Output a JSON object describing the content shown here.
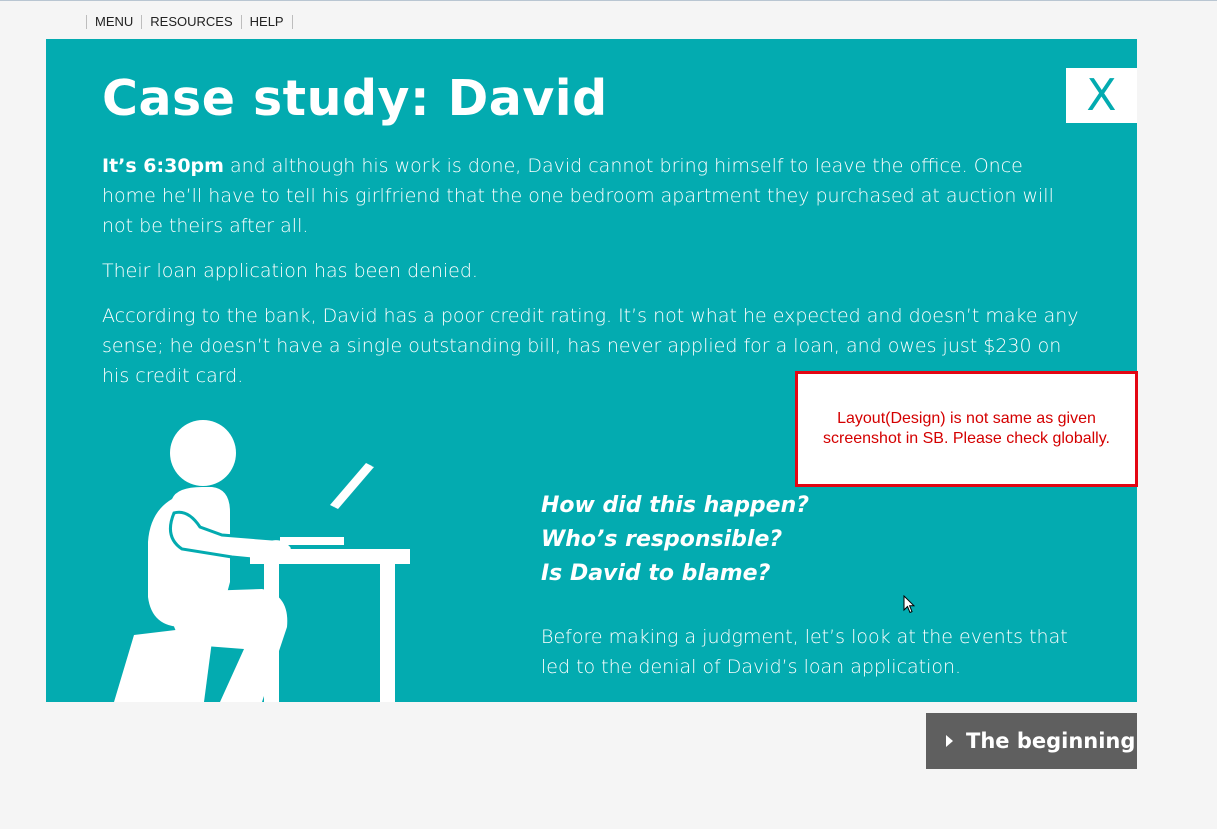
{
  "nav": {
    "items": [
      "MENU",
      "RESOURCES",
      "HELP"
    ]
  },
  "panel": {
    "title": "Case study: David",
    "close_label": "X",
    "paragraph1_bold": "It’s 6:30pm",
    "paragraph1_rest": " and although his work is done, David cannot bring himself to leave the office. Once home he’ll have to tell his girlfriend that the one bedroom apartment they purchased at auction will not be theirs after all.",
    "paragraph2": "Their loan application has been denied.",
    "paragraph3": "According to the bank, David has a poor credit rating. It’s not what he expected and doesn’t make any sense; he doesn’t have a single outstanding bill, has never applied for a loan, and owes just $230 on his credit card.",
    "questions": [
      "How did this happen?",
      "Who’s responsible?",
      "Is David to blame?"
    ],
    "paragraph4": "Before making a judgment, let’s look at the events that led to the denial of David’s loan application.",
    "illustration_icon": "person-at-laptop-icon"
  },
  "review_note": {
    "text": "Layout(Design) is not same as given screenshot in SB. Please check globally."
  },
  "next_button": {
    "label": "The beginning"
  },
  "colors": {
    "panel_bg": "#03abb0",
    "note_border": "#e30613",
    "button_bg": "#5f5f5f"
  }
}
